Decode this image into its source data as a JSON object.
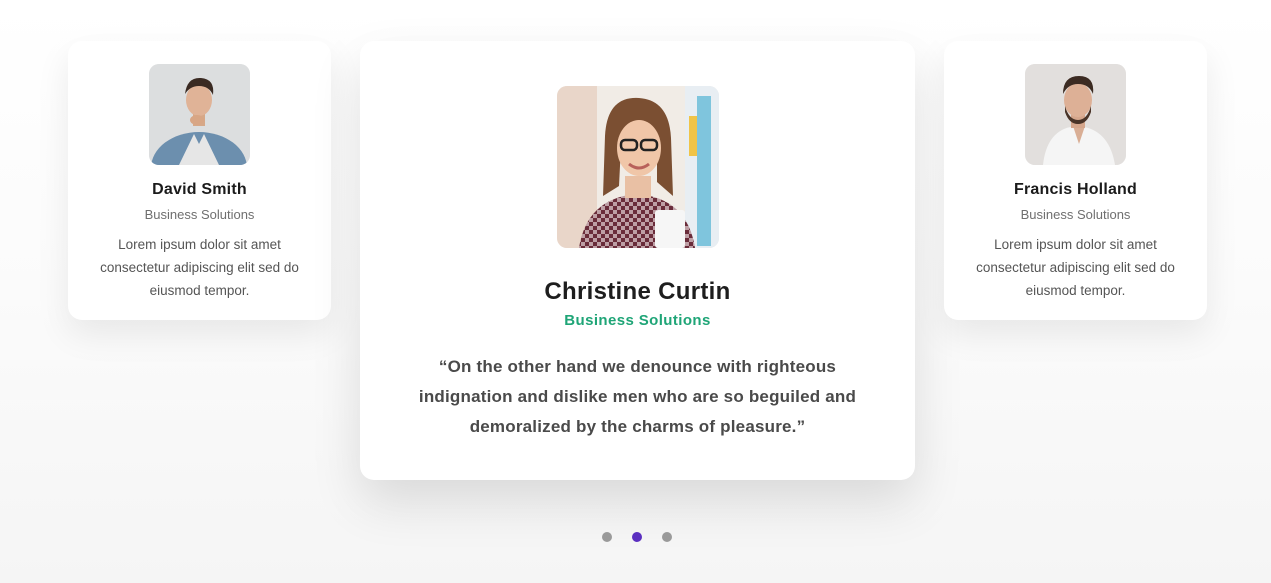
{
  "testimonials": [
    {
      "name": "David Smith",
      "role": "Business Solutions",
      "text": "Lorem ipsum dolor sit amet consectetur adipiscing elit sed do eiusmod tempor."
    },
    {
      "name": "Christine Curtin",
      "role": "Business Solutions",
      "quote": "“On the other hand we denounce with righteous indignation and dislike men who are so beguiled and demoralized by the charms of pleasure.”"
    },
    {
      "name": "Francis Holland",
      "role": "Business Solutions",
      "text": "Lorem ipsum dolor sit amet consectetur adipiscing elit sed do eiusmod tempor."
    }
  ],
  "carousel": {
    "active_index": 1,
    "dot_count": 3
  },
  "colors": {
    "accent": "#1fa577",
    "dot_active": "#5b2fc0",
    "dot_inactive": "#9a9a9a"
  }
}
